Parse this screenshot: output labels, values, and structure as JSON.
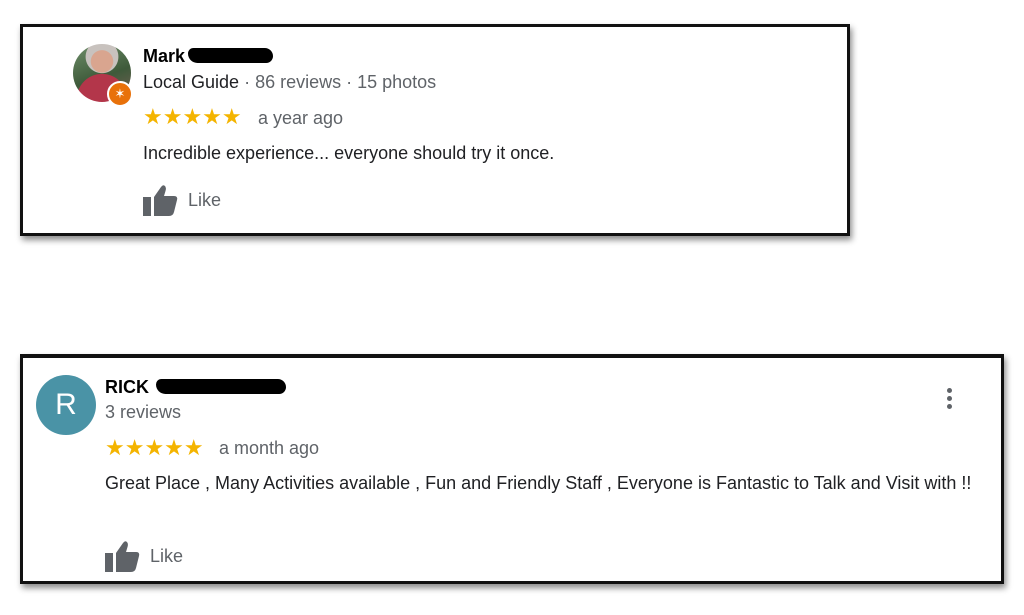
{
  "reviews": [
    {
      "name": "Mark",
      "guide_label": "Local Guide",
      "stats": " · 86 reviews · 15 photos",
      "stars": "★★★★★",
      "rating": 5,
      "age": "a year ago",
      "text": "Incredible experience... everyone should try it once.",
      "like_label": "Like"
    },
    {
      "name": "RICK",
      "avatar_letter": "R",
      "stats": "3 reviews",
      "stars": "★★★★★",
      "rating": 5,
      "age": "a month ago",
      "text": "Great Place , Many Activities available , Fun and Friendly Staff , Everyone is Fantastic to Talk and Visit with !!",
      "like_label": "Like"
    }
  ],
  "colors": {
    "star": "#f4b400",
    "avatar_r": "#4a93a6",
    "guide_badge": "#e8710a",
    "secondary_text": "#5f6368"
  },
  "icons": {
    "like": "thumbs-up-icon",
    "more": "more-vert-icon",
    "guide": "local-guide-badge-icon"
  }
}
